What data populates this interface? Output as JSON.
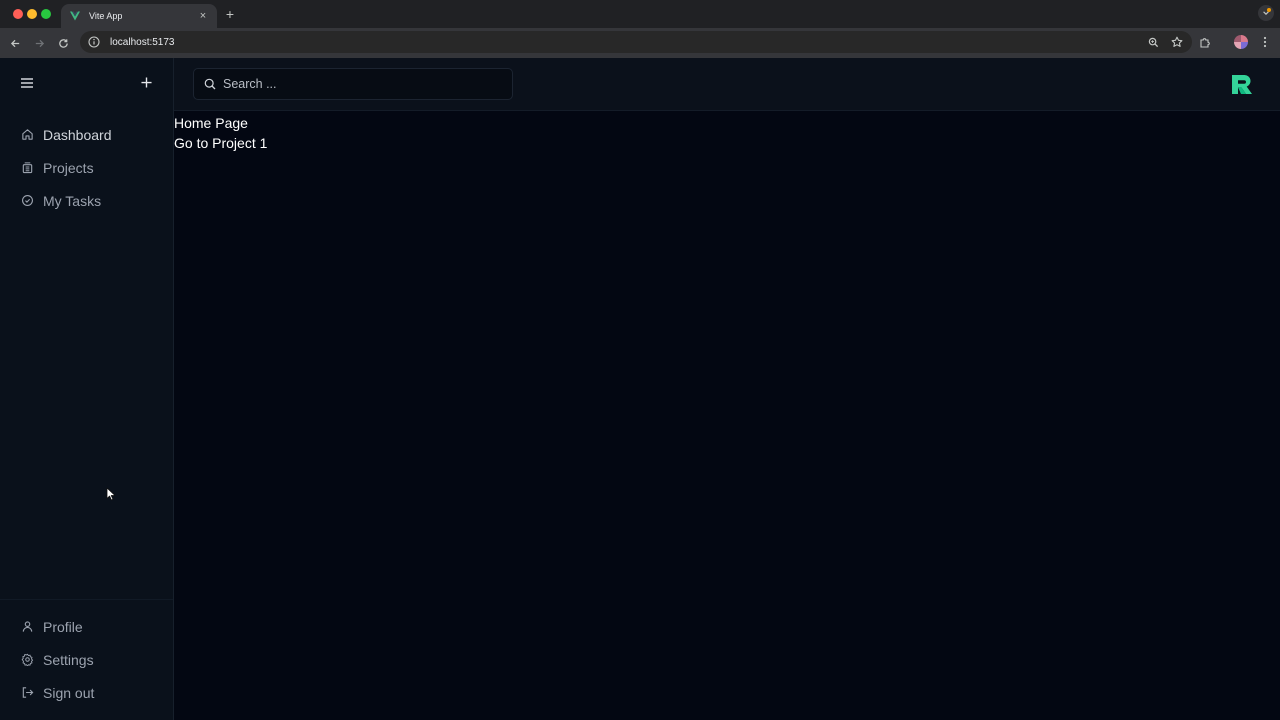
{
  "browser": {
    "tab_title": "Vite App",
    "url": "localhost:5173",
    "new_tab_label": "+",
    "tab_close_label": "×"
  },
  "sidebar": {
    "nav_items": [
      {
        "label": "Dashboard",
        "icon": "home-icon"
      },
      {
        "label": "Projects",
        "icon": "projects-icon"
      },
      {
        "label": "My Tasks",
        "icon": "check-circle-icon"
      }
    ],
    "footer_items": [
      {
        "label": "Profile",
        "icon": "user-icon"
      },
      {
        "label": "Settings",
        "icon": "gear-icon"
      },
      {
        "label": "Sign out",
        "icon": "sign-out-icon"
      }
    ]
  },
  "topbar": {
    "search_placeholder": "Search ..."
  },
  "main": {
    "heading": "Home Page",
    "link": "Go to Project 1"
  },
  "colors": {
    "background": "#030712",
    "sidebar": "#0a111b",
    "text_muted": "#9ca3af",
    "logo_primary": "#34d399",
    "logo_secondary": "#10b981"
  }
}
